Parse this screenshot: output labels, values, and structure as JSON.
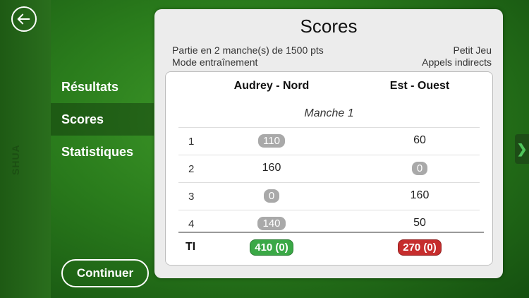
{
  "colors": {
    "accent_green": "#3aa846",
    "accent_red": "#c62d2d",
    "pill_grey": "#a9a9a9"
  },
  "left_strip": {
    "back_icon": "arrow-left-icon",
    "logo_text": "SHUA"
  },
  "menu": {
    "items": [
      {
        "label": "Résultats",
        "selected": false
      },
      {
        "label": "Scores",
        "selected": true
      },
      {
        "label": "Statistiques",
        "selected": false
      }
    ]
  },
  "continue_label": "Continuer",
  "side_tab_icon": "chevron-right-icon",
  "panel": {
    "title": "Scores",
    "info_left_1": "Partie en 2 manche(s) de 1500 pts",
    "info_left_2": "Mode entraînement",
    "info_right_1": "Petit Jeu",
    "info_right_2": "Appels indirects"
  },
  "table": {
    "col_a": "Audrey - Nord",
    "col_b": "Est - Ouest",
    "section": "Manche 1",
    "rows": [
      {
        "num": "1",
        "a": "110",
        "b": "60"
      },
      {
        "num": "2",
        "a": "160",
        "b": "0"
      },
      {
        "num": "3",
        "a": "0",
        "b": "160"
      },
      {
        "num": "4",
        "a": "140",
        "b": "50"
      }
    ],
    "total_label": "TI",
    "total_a": "410 (0)",
    "total_b": "270 (0)"
  }
}
